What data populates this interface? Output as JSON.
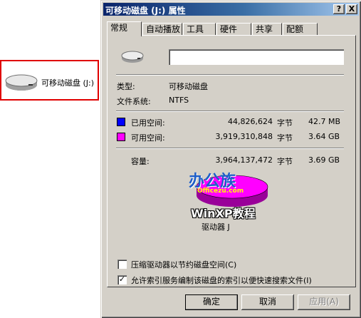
{
  "explorer": {
    "drive_label": "可移动磁盘 (J:)"
  },
  "window": {
    "title": "可移动磁盘 (J:) 属性",
    "help_button": "?",
    "close_button": "X"
  },
  "tabs": [
    {
      "label": "常规",
      "active": true
    },
    {
      "label": "自动播放",
      "active": false
    },
    {
      "label": "工具",
      "active": false
    },
    {
      "label": "硬件",
      "active": false
    },
    {
      "label": "共享",
      "active": false
    },
    {
      "label": "配额",
      "active": false
    }
  ],
  "general": {
    "volume_name_value": "",
    "type_label": "类型:",
    "type_value": "可移动磁盘",
    "fs_label": "文件系统:",
    "fs_value": "NTFS",
    "used": {
      "label": "已用空间:",
      "bytes": "44,826,624",
      "unit": "字节",
      "size": "42.7 MB",
      "color": "#0000ff"
    },
    "free": {
      "label": "可用空间:",
      "bytes": "3,919,310,848",
      "unit": "字节",
      "size": "3.64 GB",
      "color": "#ff00ff"
    },
    "capacity": {
      "label": "容量:",
      "bytes": "3,964,137,472",
      "unit": "字节",
      "size": "3.69 GB"
    },
    "drive_caption": "驱动器 J",
    "watermark": {
      "brand": "办公族",
      "site": "Officezu.com",
      "caption": "WinXP教程"
    },
    "compress_label": "压缩驱动器以节约磁盘空间(C)",
    "compress_checked": false,
    "index_label": "允许索引服务编制该磁盘的索引以便快速搜索文件(I)",
    "index_checked": true
  },
  "buttons": {
    "ok": "确定",
    "cancel": "取消",
    "apply": "应用(A)"
  }
}
